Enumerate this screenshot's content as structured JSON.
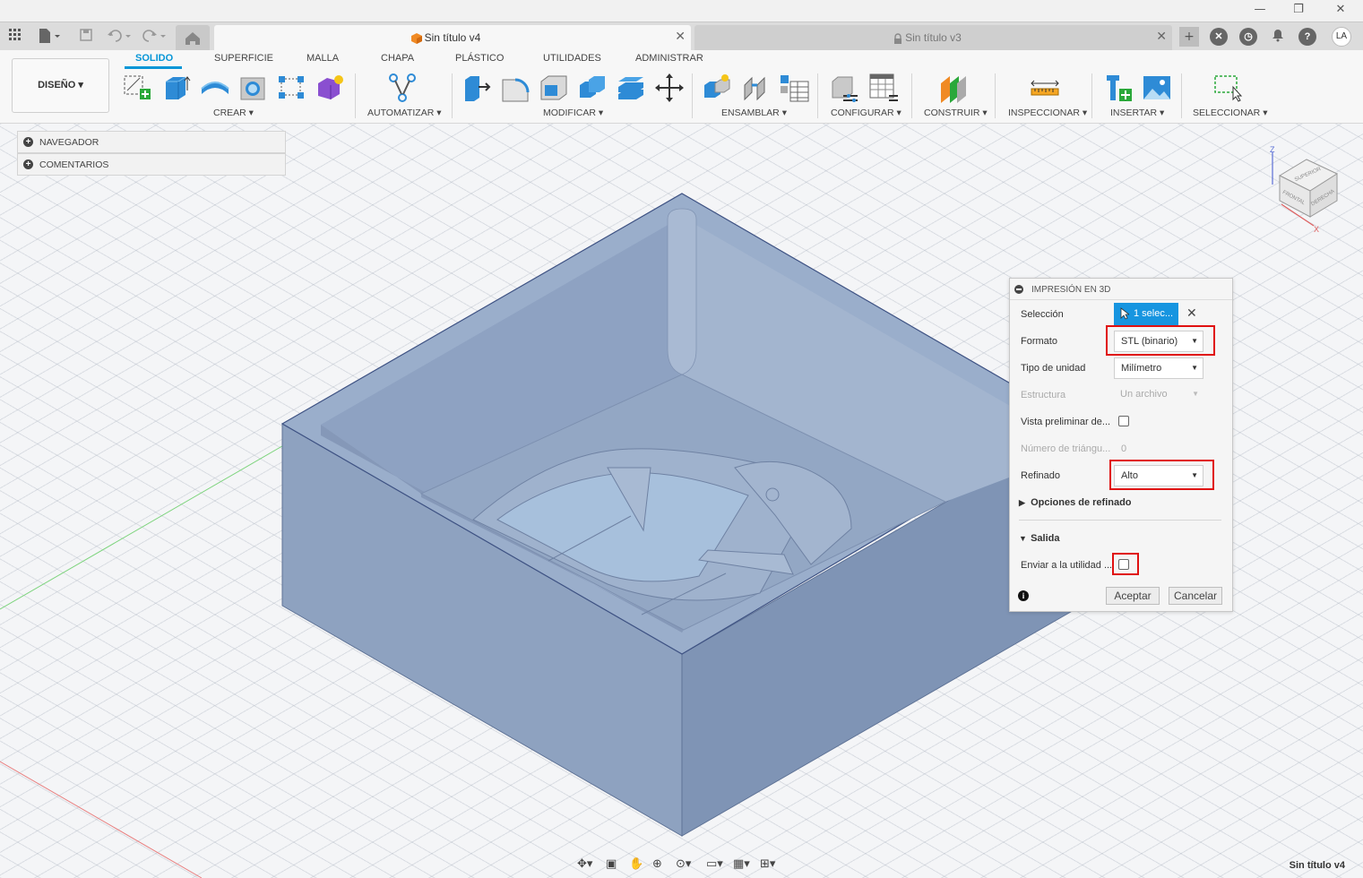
{
  "window": {
    "minimize": "—",
    "restore": "❐",
    "close": "✕"
  },
  "tabs": [
    {
      "label": "Sin título v4",
      "active": true
    },
    {
      "label": "Sin título v3",
      "active": false,
      "locked": true
    }
  ],
  "user": {
    "initials": "LA"
  },
  "toolbar": {
    "workspace": "DISEÑO",
    "workspace_tabs": [
      "SOLIDO",
      "SUPERFICIE",
      "MALLA",
      "CHAPA",
      "PLÁSTICO",
      "UTILIDADES",
      "ADMINISTRAR"
    ],
    "groups": [
      "CREAR",
      "AUTOMATIZAR",
      "MODIFICAR",
      "ENSAMBLAR",
      "CONFIGURAR",
      "CONSTRUIR",
      "INSPECCIONAR",
      "INSERTAR",
      "SELECCIONAR"
    ]
  },
  "browser": {
    "items": [
      "NAVEGADOR",
      "COMENTARIOS"
    ]
  },
  "viewcube": {
    "faces": [
      "SUPERIOR",
      "FRONTAL",
      "DERECHA"
    ],
    "axes": [
      "Z",
      "X"
    ]
  },
  "dialog": {
    "title": "IMPRESIÓN EN 3D",
    "selection_label": "Selección",
    "selection_value": "1 selec...",
    "format_label": "Formato",
    "format_value": "STL (binario)",
    "unit_label": "Tipo de unidad",
    "unit_value": "Milímetro",
    "structure_label": "Estructura",
    "structure_value": "Un archivo",
    "preview_label": "Vista preliminar de...",
    "triangles_label": "Número de triángu...",
    "triangles_value": "0",
    "refine_label": "Refinado",
    "refine_value": "Alto",
    "refine_options_label": "Opciones de refinado",
    "output_label": "Salida",
    "send_label": "Enviar a la utilidad ...",
    "ok_label": "Aceptar",
    "cancel_label": "Cancelar",
    "highlight_color": "#e01010",
    "selection_color": "#1795e0"
  },
  "status": {
    "document_name": "Sin título v4"
  },
  "colors": {
    "accent": "#0696d7",
    "model": "#93a6c2"
  }
}
